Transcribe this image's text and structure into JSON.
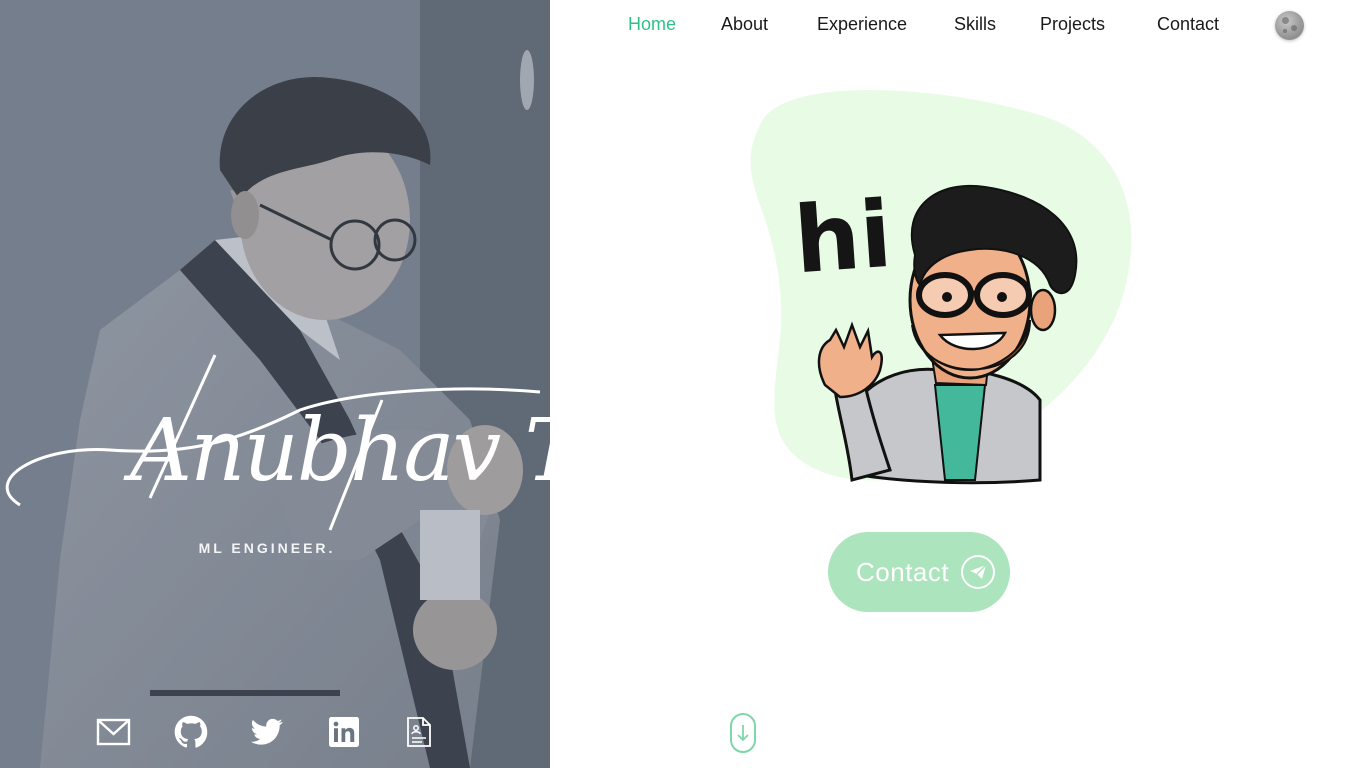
{
  "hero": {
    "name": "Anubhav Tiwari",
    "role": "ML ENGINEER.",
    "socials": [
      {
        "icon": "mail-icon"
      },
      {
        "icon": "github-icon"
      },
      {
        "icon": "twitter-icon"
      },
      {
        "icon": "linkedin-icon"
      },
      {
        "icon": "resume-icon"
      }
    ]
  },
  "nav": {
    "items": [
      {
        "label": "Home",
        "active": true
      },
      {
        "label": "About"
      },
      {
        "label": "Experience"
      },
      {
        "label": "Skills"
      },
      {
        "label": "Projects"
      },
      {
        "label": "Contact"
      }
    ],
    "theme_icon": "moon-icon"
  },
  "avatar": {
    "greeting": "hi"
  },
  "cta": {
    "label": "Contact",
    "icon": "send-icon"
  },
  "scroll": {
    "icon": "arrow-down-icon"
  },
  "colors": {
    "accent": "#2fbf8a",
    "button": "#abe4bd",
    "blob": "#e8fce5",
    "hero_overlay": "#6b7582"
  }
}
